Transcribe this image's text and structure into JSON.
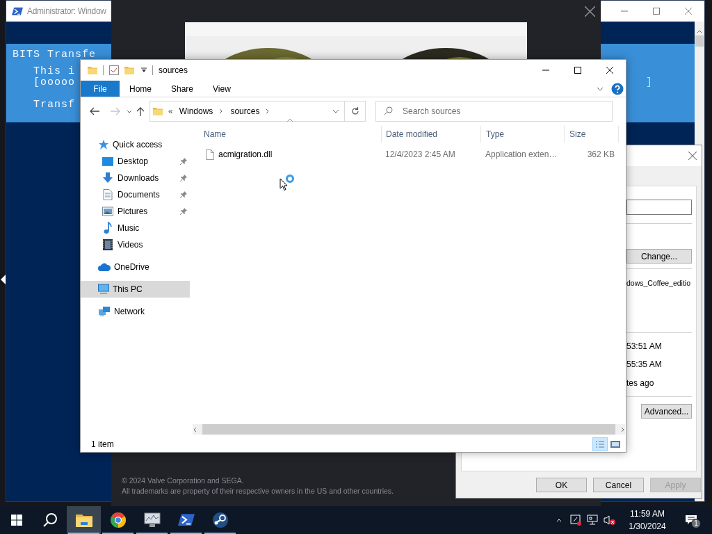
{
  "console_window": {
    "title": "Administrator: Window",
    "banner_title": "BITS Transfe",
    "activity": "This i",
    "progress": "[ooooo",
    "progress_end": "]",
    "status": "Transf"
  },
  "steam_window": {
    "copyright": "© 2024 Valve Corporation and SEGA.",
    "trademarks": "All trademarks are property of their respective owners in the US and other countries."
  },
  "properties_dialog": {
    "change_button": "Change...",
    "location": "dows_Coffee_editio",
    "created": "53:51 AM",
    "modified": "55:35 AM",
    "accessed": "tes ago",
    "advanced_button": "Advanced...",
    "buttons": [
      {
        "label": "OK",
        "disabled": false
      },
      {
        "label": "Cancel",
        "disabled": false
      },
      {
        "label": "Apply",
        "disabled": true
      }
    ]
  },
  "explorer": {
    "title": "sources",
    "ribbon": {
      "file_menu": "File",
      "tabs": [
        "Home",
        "Share",
        "View"
      ]
    },
    "address": {
      "overflow": "«",
      "crumbs": [
        "Windows",
        "sources"
      ]
    },
    "search": {
      "placeholder": "Search sources"
    },
    "sidebar": {
      "items": [
        {
          "label": "Quick access",
          "selected": false,
          "children": [
            {
              "label": "Desktop",
              "pinned": true,
              "selected": false
            },
            {
              "label": "Downloads",
              "pinned": true,
              "selected": false
            },
            {
              "label": "Documents",
              "pinned": true,
              "selected": false
            },
            {
              "label": "Pictures",
              "pinned": true,
              "selected": false
            },
            {
              "label": "Music",
              "pinned": false,
              "selected": false
            },
            {
              "label": "Videos",
              "pinned": false,
              "selected": false
            }
          ]
        },
        {
          "label": "OneDrive",
          "selected": false
        },
        {
          "label": "This PC",
          "selected": true
        },
        {
          "label": "Network",
          "selected": false
        }
      ]
    },
    "columns": [
      {
        "label": "Name",
        "sorted": true
      },
      {
        "label": "Date modified",
        "sorted": false
      },
      {
        "label": "Type",
        "sorted": false
      },
      {
        "label": "Size",
        "sorted": false
      }
    ],
    "rows": [
      {
        "name": "acmigration.dll",
        "date_modified": "12/4/2023 2:45 AM",
        "type": "Application exten…",
        "size": "362 KB"
      }
    ],
    "status": "1 item",
    "views": [
      {
        "selected": true
      },
      {
        "selected": false
      }
    ]
  },
  "taskbar": {
    "apps": [
      {
        "active": true,
        "running": true
      },
      {
        "active": false,
        "running": true
      },
      {
        "active": false,
        "running": true
      },
      {
        "active": false,
        "running": true
      },
      {
        "active": false,
        "running": true
      }
    ],
    "clock": {
      "time": "11:59 AM",
      "date": "1/30/2024"
    },
    "notifications": "1"
  }
}
